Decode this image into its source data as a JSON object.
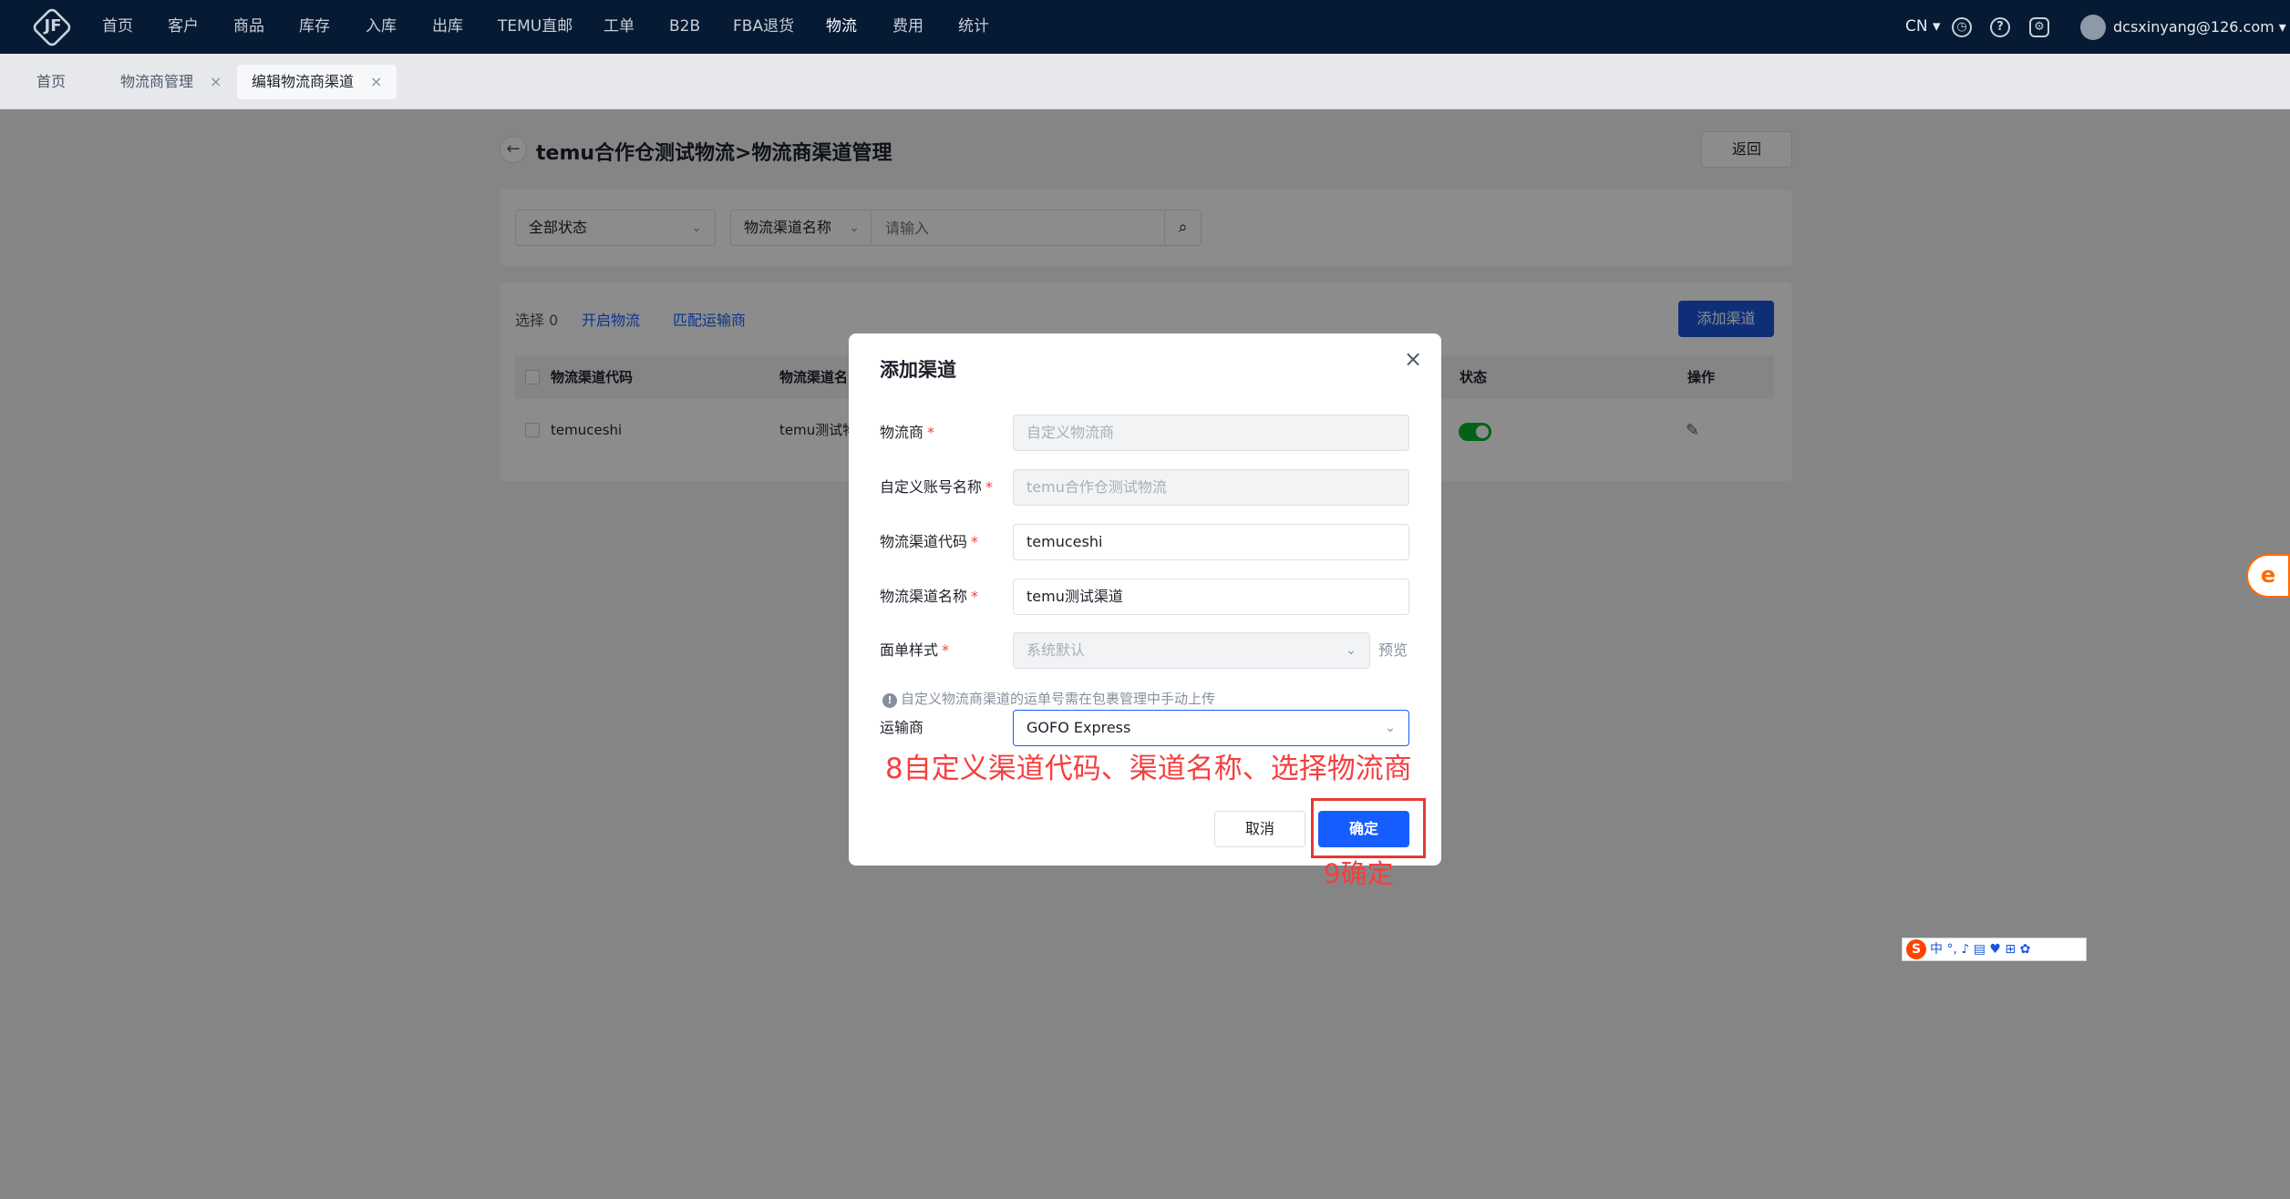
{
  "nav": {
    "logo_text": "JF",
    "items": [
      "首页",
      "客户",
      "商品",
      "库存",
      "入库",
      "出库",
      "TEMU直邮",
      "工单",
      "B2B",
      "FBA退货",
      "物流",
      "费用",
      "统计"
    ],
    "lang": "CN ▾",
    "user": "dcsxinyang@126.com ▾"
  },
  "tabs": [
    {
      "label": "首页"
    },
    {
      "label": "物流商管理",
      "close": "×"
    },
    {
      "label": "编辑物流商渠道",
      "close": "×"
    }
  ],
  "page": {
    "back_icon": "←",
    "title_part1": "temu合作仓测试物流",
    "title_part2": ">物流商渠道管理",
    "return_label": "返回"
  },
  "filters": {
    "status_select": "全部状态",
    "search_type": "物流渠道名称",
    "search_placeholder": "请输入",
    "search_icon": "⌕"
  },
  "toolbar": {
    "selected": "选择 0",
    "enable_logistics": "开启物流",
    "match_carrier": "匹配运输商",
    "add_channel": "添加渠道"
  },
  "table": {
    "headers": {
      "code": "物流渠道代码",
      "name": "物流渠道名",
      "status": "状态",
      "action": "操作"
    },
    "rows": [
      {
        "code": "temuceshi",
        "name": "temu测试物",
        "status_on": true,
        "edit_icon": "✎"
      }
    ]
  },
  "modal": {
    "title": "添加渠道",
    "close_icon": "×",
    "fields": {
      "carrier": {
        "label": "物流商",
        "required": "*",
        "value": "自定义物流商"
      },
      "account": {
        "label": "自定义账号名称",
        "required": "*",
        "value": "temu合作仓测试物流"
      },
      "channel_code": {
        "label": "物流渠道代码",
        "required": "*",
        "value": "temuceshi"
      },
      "channel_name": {
        "label": "物流渠道名称",
        "required": "*",
        "value": "temu测试渠道"
      },
      "label_style": {
        "label": "面单样式",
        "required": "*",
        "value": "系统默认",
        "preview": "预览"
      },
      "transport": {
        "label": "运输商",
        "value": "GOFO Express"
      }
    },
    "hint_icon": "!",
    "hint": "自定义物流商渠道的运单号需在包裹管理中手动上传",
    "cancel_label": "取消",
    "ok_label": "确定"
  },
  "annotations": {
    "step8": "8自定义渠道代码、渠道名称、选择物流商",
    "step9": "9确定"
  },
  "widgets": {
    "side_badge": "e",
    "ime_logo": "S",
    "ime_rest": "中 °, ♪ ▤ ♥ ⊞ ✿"
  }
}
